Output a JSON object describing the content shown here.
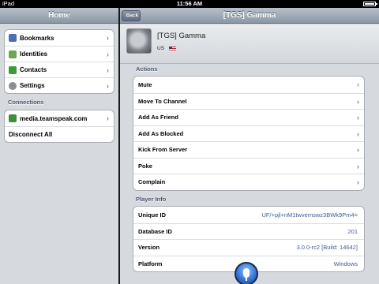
{
  "status": {
    "device": "iPad",
    "time": "11:56 AM"
  },
  "left": {
    "title": "Home",
    "menu": [
      {
        "label": "Bookmarks",
        "icon": "book-icon",
        "color": "#4a6fb5"
      },
      {
        "label": "Identities",
        "icon": "identity-icon",
        "color": "#6aa84f"
      },
      {
        "label": "Contacts",
        "icon": "contacts-icon",
        "color": "#3c9a3c"
      },
      {
        "label": "Settings",
        "icon": "gear-icon",
        "color": "#8a8f96"
      }
    ],
    "connections_header": "Connections",
    "connections": [
      {
        "label": "media.teamspeak.com",
        "icon": "server-icon",
        "color": "#3c8f3c"
      },
      {
        "label": "Disconnect All"
      }
    ]
  },
  "right": {
    "back_label": "Back",
    "title": "[TGS] Gamma",
    "client_name": "[TGS] Gamma",
    "country": "US",
    "actions_header": "Actions",
    "actions": [
      "Mute",
      "Move To Channel",
      "Add As Friend",
      "Add As Blocked",
      "Kick From Server",
      "Poke",
      "Complain"
    ],
    "info_header": "Player Info",
    "info": [
      {
        "label": "Unique ID",
        "value": "UF/+pjl+nM1twvemswz3BWk9Pm4="
      },
      {
        "label": "Database ID",
        "value": "201"
      },
      {
        "label": "Version",
        "value": "3.0.0-rc2 [Build: 14642]"
      },
      {
        "label": "Platform",
        "value": "Windows"
      }
    ]
  }
}
